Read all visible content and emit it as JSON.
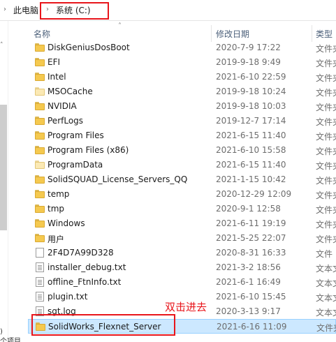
{
  "address_bar": {
    "parent": "此电脑",
    "current": "系统 (C:)"
  },
  "columns": {
    "name": "名称",
    "date": "修改日期",
    "type": "类型"
  },
  "rows": [
    {
      "name": "DiskGeniusDosBoot",
      "date": "2020-7-9 17:22",
      "type": "文件夹",
      "icon": "folder-icon"
    },
    {
      "name": "EFI",
      "date": "2019-9-18 9:49",
      "type": "文件夹",
      "icon": "folder-icon"
    },
    {
      "name": "Intel",
      "date": "2021-6-10 22:59",
      "type": "文件夹",
      "icon": "folder-icon"
    },
    {
      "name": "MSOCache",
      "date": "2019-9-18 10:24",
      "type": "文件夹",
      "icon": "folder-icon"
    },
    {
      "name": "NVIDIA",
      "date": "2019-9-18 10:03",
      "type": "文件夹",
      "icon": "folder-icon"
    },
    {
      "name": "PerfLogs",
      "date": "2019-12-7 17:14",
      "type": "文件夹",
      "icon": "folder-icon"
    },
    {
      "name": "Program Files",
      "date": "2021-6-15 11:40",
      "type": "文件夹",
      "icon": "folder-icon"
    },
    {
      "name": "Program Files (x86)",
      "date": "2021-6-10 15:58",
      "type": "文件夹",
      "icon": "folder-icon"
    },
    {
      "name": "ProgramData",
      "date": "2021-6-15 11:40",
      "type": "文件夹",
      "icon": "folder-icon"
    },
    {
      "name": "SolidSQUAD_License_Servers_QQ",
      "date": "2021-1-15 10:42",
      "type": "文件夹",
      "icon": "folder-icon"
    },
    {
      "name": "temp",
      "date": "2020-12-29 12:09",
      "type": "文件夹",
      "icon": "folder-icon"
    },
    {
      "name": "tmp",
      "date": "2020-9-1 12:58",
      "type": "文件夹",
      "icon": "folder-icon"
    },
    {
      "name": "Windows",
      "date": "2021-6-11 19:19",
      "type": "文件夹",
      "icon": "folder-icon"
    },
    {
      "name": "用户",
      "date": "2021-5-25 22:07",
      "type": "文件夹",
      "icon": "folder-icon"
    },
    {
      "name": "2F4D7A99D328",
      "date": "2020-8-31 16:33",
      "type": "文件",
      "icon": "file-icon"
    },
    {
      "name": "installer_debug.txt",
      "date": "2021-3-2 18:56",
      "type": "文本文档",
      "icon": "text-file-icon"
    },
    {
      "name": "offline_FtnInfo.txt",
      "date": "2021-6-1 16:49",
      "type": "文本文档",
      "icon": "text-file-icon"
    },
    {
      "name": "plugin.txt",
      "date": "2021-6-10 15:45",
      "type": "文本文档",
      "icon": "text-file-icon"
    },
    {
      "name": "sgt.log",
      "date": "2020-3-13 9:17",
      "type": "文本文档",
      "icon": "text-file-icon"
    },
    {
      "name": "SolidWorks_Flexnet_Server",
      "date": "2021-6-16 11:09",
      "type": "文件夹",
      "icon": "folder-icon"
    }
  ],
  "annotation": "双击进去",
  "status_bar": "个项目",
  "colors": {
    "highlight_red": "#e8151b",
    "selection_bg": "#cce8ff",
    "folder_yellow": "#f5c94f"
  }
}
